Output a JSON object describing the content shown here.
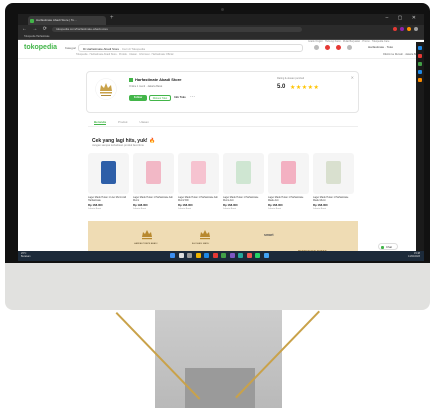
{
  "browser": {
    "tab_title": "Harfastinate Abadi Store | To...",
    "new_tab": "+",
    "window_controls": "– ▢ ✕",
    "url": "tokopedia.com/harfastinate-abadi-store",
    "nav": "← → ⟳",
    "bookmarks": "Tokopedia Harfastinate"
  },
  "header": {
    "logo": "tokopedia",
    "kategori": "Kategori",
    "search_scope": "Di Harfastinate Abadi Store",
    "search_placeholder": "Cari di Tokopedia",
    "top_links": "Gratis Ongkir · Hubungi Kami · Mulai Berjualan · Promo · Tokopedia Care",
    "subnav": "Tokopedia · Harfastinate Abadi Store · Produk · Ulasan · Informasi · Harfastinate Official",
    "user": "Harfastinate · Toko",
    "send_to": "Dikirim ke Rumah · Jakarta Barat"
  },
  "shop": {
    "name": "Harfastinate Abadi Store",
    "meta": "Online 1 menit · Jakarta Barat",
    "follow": "Follow",
    "discuss": "Diskusi Toko",
    "info": "Info Toko",
    "more": "⋯",
    "rating_label": "Rating & ulasan pembeli",
    "rating_value": "5.0",
    "stars": "★★★★★",
    "close": "✕"
  },
  "tabs": {
    "beranda": "Beranda",
    "produk": "Produk",
    "ulasan": "Ulasan"
  },
  "section": {
    "title": "Cek yang lagi hits, yuk! 🔥",
    "subtitle": "Jangan sampai kehabisan produk favoritmu"
  },
  "products": [
    {
      "name": "Lager Madu Hutan 1 Liter Murni Asli Harfastinate",
      "price": "Rp 168.000",
      "location": "Jakarta Barat",
      "color": "#2e5fa8"
    },
    {
      "name": "Lager Madu Hutan 1 Harfastinate Asli Murni",
      "price": "Rp 198.000",
      "location": "Jakarta Barat",
      "color": "#f2b8c6"
    },
    {
      "name": "Lager Madu Hutan 1 Harfastinate Asli Murni 500",
      "price": "Rp 168.000",
      "location": "Jakarta Barat",
      "color": "#f6c3d0"
    },
    {
      "name": "Lager Madu Hutan 1 Harfastinate Murni Asli",
      "price": "Rp 168.000",
      "location": "Jakarta Barat",
      "color": "#cfe6d2"
    },
    {
      "name": "Lager Madu Hutan 1 Harfastinate Madu Asli",
      "price": "Rp 168.000",
      "location": "Jakarta Barat",
      "color": "#f3b1c2"
    },
    {
      "name": "Lager Madu Hutan 1 Harfastinate Madu Murni",
      "price": "Rp 168.000",
      "location": "Jakarta Barat",
      "color": "#d9e0cf"
    }
  ],
  "banner": {
    "cap1": "HARFASTINATE ABADI",
    "cap2": "ASOSIASI MADU",
    "smart": "smart",
    "tagline": "PASTI KHAS BATAK"
  },
  "chat": {
    "label": "Chat"
  },
  "taskbar": {
    "weather_temp": "29°C",
    "weather_desc": "Berawan",
    "time": "15:48",
    "date": "14/02/2023"
  },
  "colors": {
    "brand": "#42b549",
    "star": "#ffc400",
    "gold_line": "#c9a24a"
  }
}
